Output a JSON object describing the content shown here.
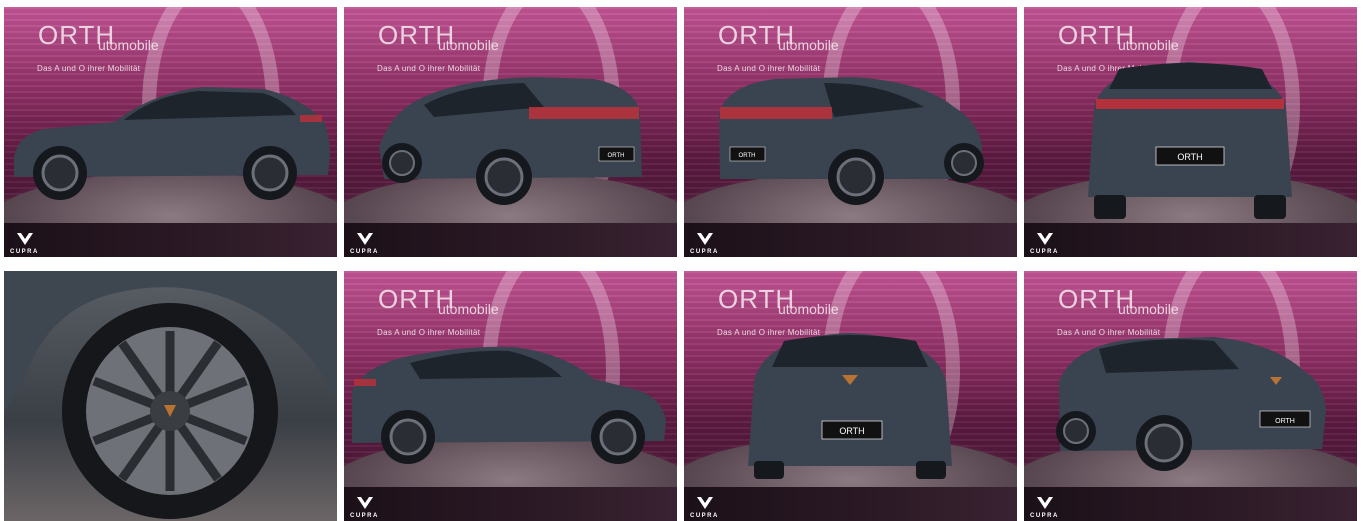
{
  "gallery": {
    "tiles": [
      {
        "view": "side-left",
        "dealer": "ORTH",
        "dealer_sub": "utomobile",
        "slogan": "Das A und O ihrer Mobilität",
        "brand": "CUPRA",
        "plate_text": ""
      },
      {
        "view": "rear-three-quarter-left",
        "dealer": "ORTH",
        "dealer_sub": "utomobile",
        "slogan": "Das A und O ihrer Mobilität",
        "brand": "CUPRA",
        "plate_text": "ORTH"
      },
      {
        "view": "rear-three-quarter-right",
        "dealer": "ORTH",
        "dealer_sub": "utomobile",
        "slogan": "Das A und O ihrer Mobilität",
        "brand": "CUPRA",
        "plate_text": "ORTH"
      },
      {
        "view": "rear",
        "dealer": "ORTH",
        "dealer_sub": "utomobile",
        "slogan": "Das A und O ihrer Mobilität",
        "brand": "CUPRA",
        "plate_text": "ORTH"
      },
      {
        "view": "wheel-closeup",
        "dealer": "",
        "dealer_sub": "",
        "slogan": "",
        "brand": "",
        "plate_text": ""
      },
      {
        "view": "side-right",
        "dealer": "ORTH",
        "dealer_sub": "utomobile",
        "slogan": "Das A und O ihrer Mobilität",
        "brand": "CUPRA",
        "plate_text": ""
      },
      {
        "view": "front",
        "dealer": "ORTH",
        "dealer_sub": "utomobile",
        "slogan": "Das A und O ihrer Mobilität",
        "brand": "CUPRA",
        "plate_text": "ORTH"
      },
      {
        "view": "front-three-quarter-right",
        "dealer": "ORTH",
        "dealer_sub": "utomobile",
        "slogan": "Das A und O ihrer Mobilität",
        "brand": "CUPRA",
        "plate_text": "ORTH"
      }
    ]
  },
  "colors": {
    "backdrop_top": "#c45596",
    "backdrop_bottom": "#3d1530",
    "car_body": "#3a4350",
    "taillight": "#c0303a",
    "copper_accent": "#b87333"
  }
}
